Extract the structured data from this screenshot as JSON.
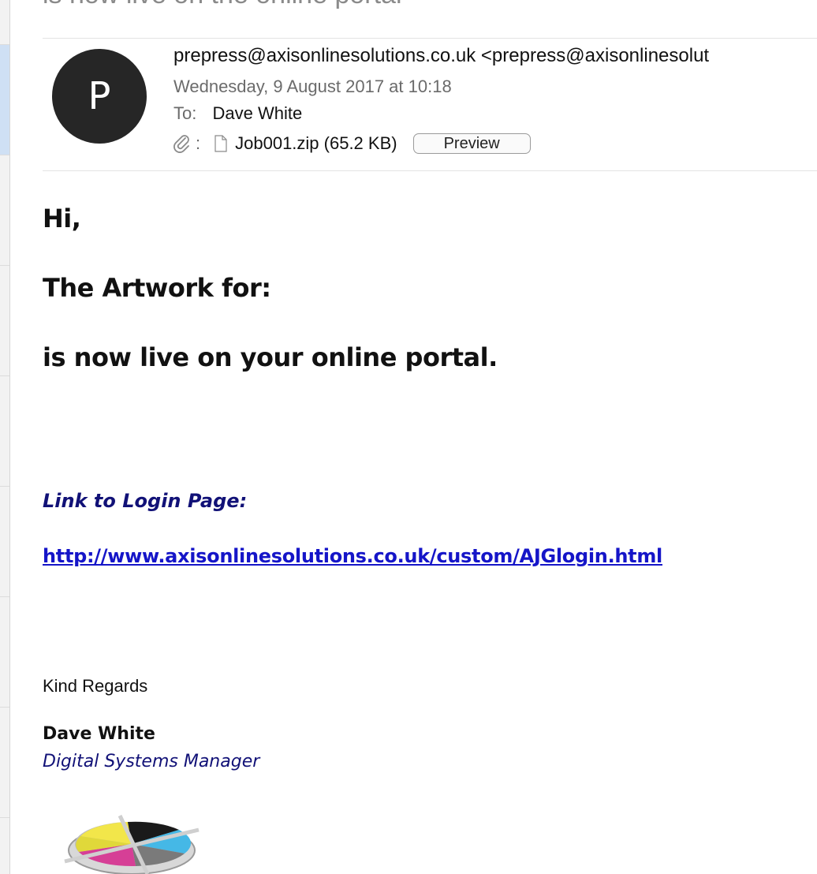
{
  "subject": "is now live on the online portal",
  "header": {
    "avatar_letter": "P",
    "from": "prepress@axisonlinesolutions.co.uk <prepress@axisonlinesolut",
    "date": "Wednesday, 9 August 2017 at 10:18",
    "to_label": "To:",
    "to_name": "Dave White",
    "attachment_colon": ":",
    "attachment_name": "Job001.zip (65.2 KB)",
    "preview_label": "Preview"
  },
  "body": {
    "greeting": "Hi,",
    "artwork_line": "The Artwork for:",
    "live_line": "is now live on your online portal.",
    "link_label": "Link to Login Page:",
    "login_url": "http://www.axisonlinesolutions.co.uk/custom/AJGlogin.html"
  },
  "signature": {
    "regards": "Kind Regards",
    "name": "Dave White",
    "title": "Digital Systems Manager"
  },
  "icons": {
    "attachment": "paperclip-icon",
    "file": "file-icon",
    "logo": "cmyk-logo"
  },
  "colors": {
    "avatar_bg": "#262626",
    "link_blue": "#1515c8",
    "navy": "#111177",
    "selection": "#cfe0f4"
  }
}
